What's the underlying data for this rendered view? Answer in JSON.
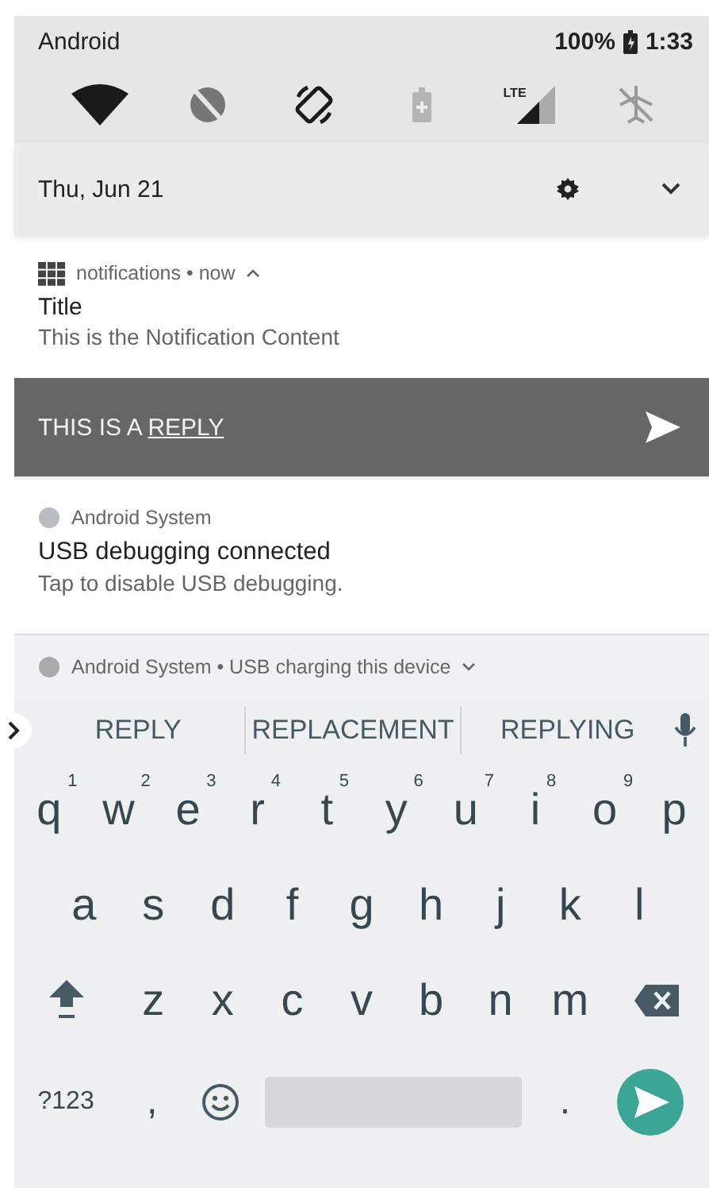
{
  "status_bar": {
    "carrier": "Android",
    "battery": "100%",
    "time": "1:33"
  },
  "quick_settings": [
    {
      "kind": "wifi",
      "on": true
    },
    {
      "kind": "dnd",
      "on": false
    },
    {
      "kind": "rotate",
      "on": true
    },
    {
      "kind": "battery_saver",
      "on": false
    },
    {
      "kind": "mobile_data",
      "on": true,
      "badge": "LTE"
    },
    {
      "kind": "airplane",
      "on": false
    }
  ],
  "date": "Thu, Jun 21",
  "notifications": [
    {
      "kind": "reply",
      "header": "notifications • now",
      "title": "Title",
      "text": "This is the Notification Content",
      "reply": {
        "text": "THIS IS A",
        "link": "REPLY"
      }
    },
    {
      "kind": "full",
      "header": "Android System",
      "title": "USB debugging connected",
      "text": "Tap to disable USB debugging."
    },
    {
      "kind": "collapsed",
      "header": "Android System • USB charging this device"
    }
  ],
  "keyboard": {
    "suggestions": [
      "REPLY",
      "REPLACEMENT",
      "REPLYING"
    ],
    "rows": [
      [
        {
          "kind": "letter",
          "label": "q",
          "hint": "1"
        },
        {
          "kind": "letter",
          "label": "w",
          "hint": "2"
        },
        {
          "kind": "letter",
          "label": "e",
          "hint": "3"
        },
        {
          "kind": "letter",
          "label": "r",
          "hint": "4"
        },
        {
          "kind": "letter",
          "label": "t",
          "hint": "5"
        },
        {
          "kind": "letter",
          "label": "y",
          "hint": "6"
        },
        {
          "kind": "letter",
          "label": "u",
          "hint": "7"
        },
        {
          "kind": "letter",
          "label": "i",
          "hint": "8"
        },
        {
          "kind": "letter",
          "label": "o",
          "hint": "9"
        },
        {
          "kind": "letter",
          "label": "p"
        }
      ],
      [
        {
          "kind": "letter",
          "label": "a"
        },
        {
          "kind": "letter",
          "label": "s"
        },
        {
          "kind": "letter",
          "label": "d"
        },
        {
          "kind": "letter",
          "label": "f"
        },
        {
          "kind": "letter",
          "label": "g"
        },
        {
          "kind": "letter",
          "label": "h"
        },
        {
          "kind": "letter",
          "label": "j"
        },
        {
          "kind": "letter",
          "label": "k"
        },
        {
          "kind": "letter",
          "label": "l"
        }
      ],
      [
        {
          "kind": "shift"
        },
        {
          "kind": "letter",
          "label": "z"
        },
        {
          "kind": "letter",
          "label": "x"
        },
        {
          "kind": "letter",
          "label": "c"
        },
        {
          "kind": "letter",
          "label": "v"
        },
        {
          "kind": "letter",
          "label": "b"
        },
        {
          "kind": "letter",
          "label": "n"
        },
        {
          "kind": "letter",
          "label": "m"
        },
        {
          "kind": "backspace"
        }
      ]
    ],
    "bottom_row": [
      {
        "kind": "symbols",
        "label": "?123"
      },
      {
        "kind": "punct",
        "label": ","
      },
      {
        "kind": "emoji"
      },
      {
        "kind": "space"
      },
      {
        "kind": "punct",
        "label": "."
      },
      {
        "kind": "send"
      }
    ]
  }
}
